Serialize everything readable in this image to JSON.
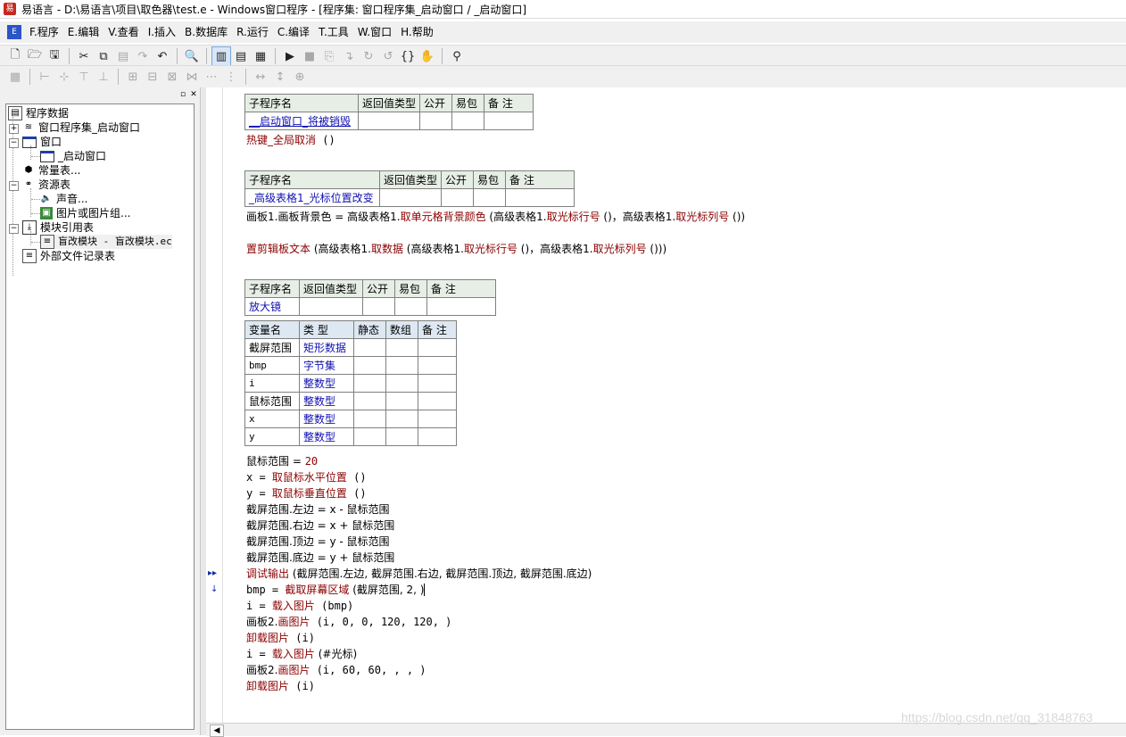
{
  "title": "易语言 - D:\\易语言\\项目\\取色器\\test.e - Windows窗口程序 - [程序集: 窗口程序集_启动窗口 / _启动窗口]",
  "menu": [
    "F.程序",
    "E.编辑",
    "V.查看",
    "I.插入",
    "B.数据库",
    "R.运行",
    "C.编译",
    "T.工具",
    "W.窗口",
    "H.帮助"
  ],
  "tree": {
    "root": "程序数据",
    "n1": "窗口程序集_启动窗口",
    "n2": "窗口",
    "n2a": "_启动窗口",
    "n3": "常量表...",
    "n4": "资源表",
    "n4a": "声音...",
    "n4b": "图片或图片组...",
    "n5": "模块引用表",
    "n5a": "盲改模块 - 盲改模块.ec",
    "n6": "外部文件记录表"
  },
  "sub_header": [
    "子程序名",
    "返回值类型",
    "公开",
    "易包",
    "备 注"
  ],
  "var_header": [
    "变量名",
    "类 型",
    "静态",
    "数组",
    "备 注"
  ],
  "sub1": {
    "name": "__启动窗口_将被销毁"
  },
  "line1": {
    "fn": "热键_全局取消",
    "rest": " ()"
  },
  "sub2": {
    "name": "_高级表格1_光标位置改变"
  },
  "line2": {
    "a": "画板1.画板背景色 = 高级表格1.",
    "f1": "取单元格背景颜色",
    "b": " (高级表格1.",
    "f2": "取光标行号",
    "c": " ()，高级表格1.",
    "f3": "取光标列号",
    "d": " ())"
  },
  "line3": {
    "f1": "置剪辑板文本",
    "a": " (高级表格1.",
    "f2": "取数据",
    "b": " (高级表格1.",
    "f3": "取光标行号",
    "c": " ()，高级表格1.",
    "f4": "取光标列号",
    "d": " ()))"
  },
  "sub3": {
    "name": "放大镜"
  },
  "vars": [
    {
      "name": "截屏范围",
      "type": "矩形数据"
    },
    {
      "name": "bmp",
      "type": "字节集"
    },
    {
      "name": "i",
      "type": "整数型"
    },
    {
      "name": "鼠标范围",
      "type": "整数型"
    },
    {
      "name": "x",
      "type": "整数型"
    },
    {
      "name": "y",
      "type": "整数型"
    }
  ],
  "code": {
    "c1a": "鼠标范围 = ",
    "c1n": "20",
    "c2a": "x = ",
    "c2f": "取鼠标水平位置",
    "c2b": " ()",
    "c3a": "y = ",
    "c3f": "取鼠标垂直位置",
    "c3b": " ()",
    "c4": "截屏范围.左边 = x - 鼠标范围",
    "c5": "截屏范围.右边 = x + 鼠标范围",
    "c6": "截屏范围.顶边 = y - 鼠标范围",
    "c7": "截屏范围.底边 = y + 鼠标范围",
    "c8f": "调试输出",
    "c8b": " (截屏范围.左边, 截屏范围.右边, 截屏范围.顶边, 截屏范围.底边)",
    "c9a": "bmp = ",
    "c9f": "截取屏幕区域",
    "c9b": " (截屏范围, 2, )",
    "c10a": "i = ",
    "c10f": "载入图片",
    "c10b": " (bmp)",
    "c11a": "画板2.",
    "c11f": "画图片",
    "c11b": " (i, 0, 0, 120, 120, )",
    "c12f": "卸载图片",
    "c12b": " (i)",
    "c13a": "i = ",
    "c13f": "载入图片",
    "c13b": " (#光标)",
    "c14a": "画板2.",
    "c14f": "画图片",
    "c14b": " (i, 60, 60, , , )",
    "c15f": "卸载图片",
    "c15b": " (i)"
  },
  "watermark": "https://blog.csdn.net/qq_31848763"
}
